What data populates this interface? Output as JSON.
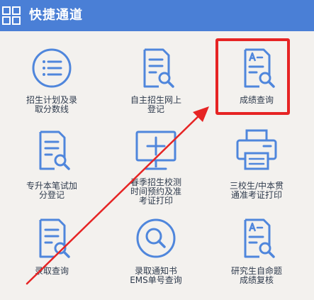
{
  "header": {
    "title": "快捷通道",
    "icon": "grid-icon",
    "color": "#4a7fd6"
  },
  "icon_color": "#4f86dc",
  "highlight_color": "#e62424",
  "items": [
    {
      "label": "招生计划及录\n取分数线",
      "icon": "list-circle-icon"
    },
    {
      "label": "自主招生网上\n登记",
      "icon": "document-search-icon"
    },
    {
      "label": "成绩查询",
      "icon": "grade-document-search-icon"
    },
    {
      "label": "专升本笔试加\n分登记",
      "icon": "document-search-icon"
    },
    {
      "label": "春季招生校测\n时间预约及准\n考证打印",
      "icon": "monitor-plus-icon"
    },
    {
      "label": "三校生/中本贯\n通准考证打印",
      "icon": "printer-icon"
    },
    {
      "label": "录取查询",
      "icon": "document-search-icon"
    },
    {
      "label": "录取通知书\nEMS单号查询",
      "icon": "magnifier-circle-icon"
    },
    {
      "label": "研究生自命题\n成绩复核",
      "icon": "grade-document-search-icon"
    }
  ]
}
